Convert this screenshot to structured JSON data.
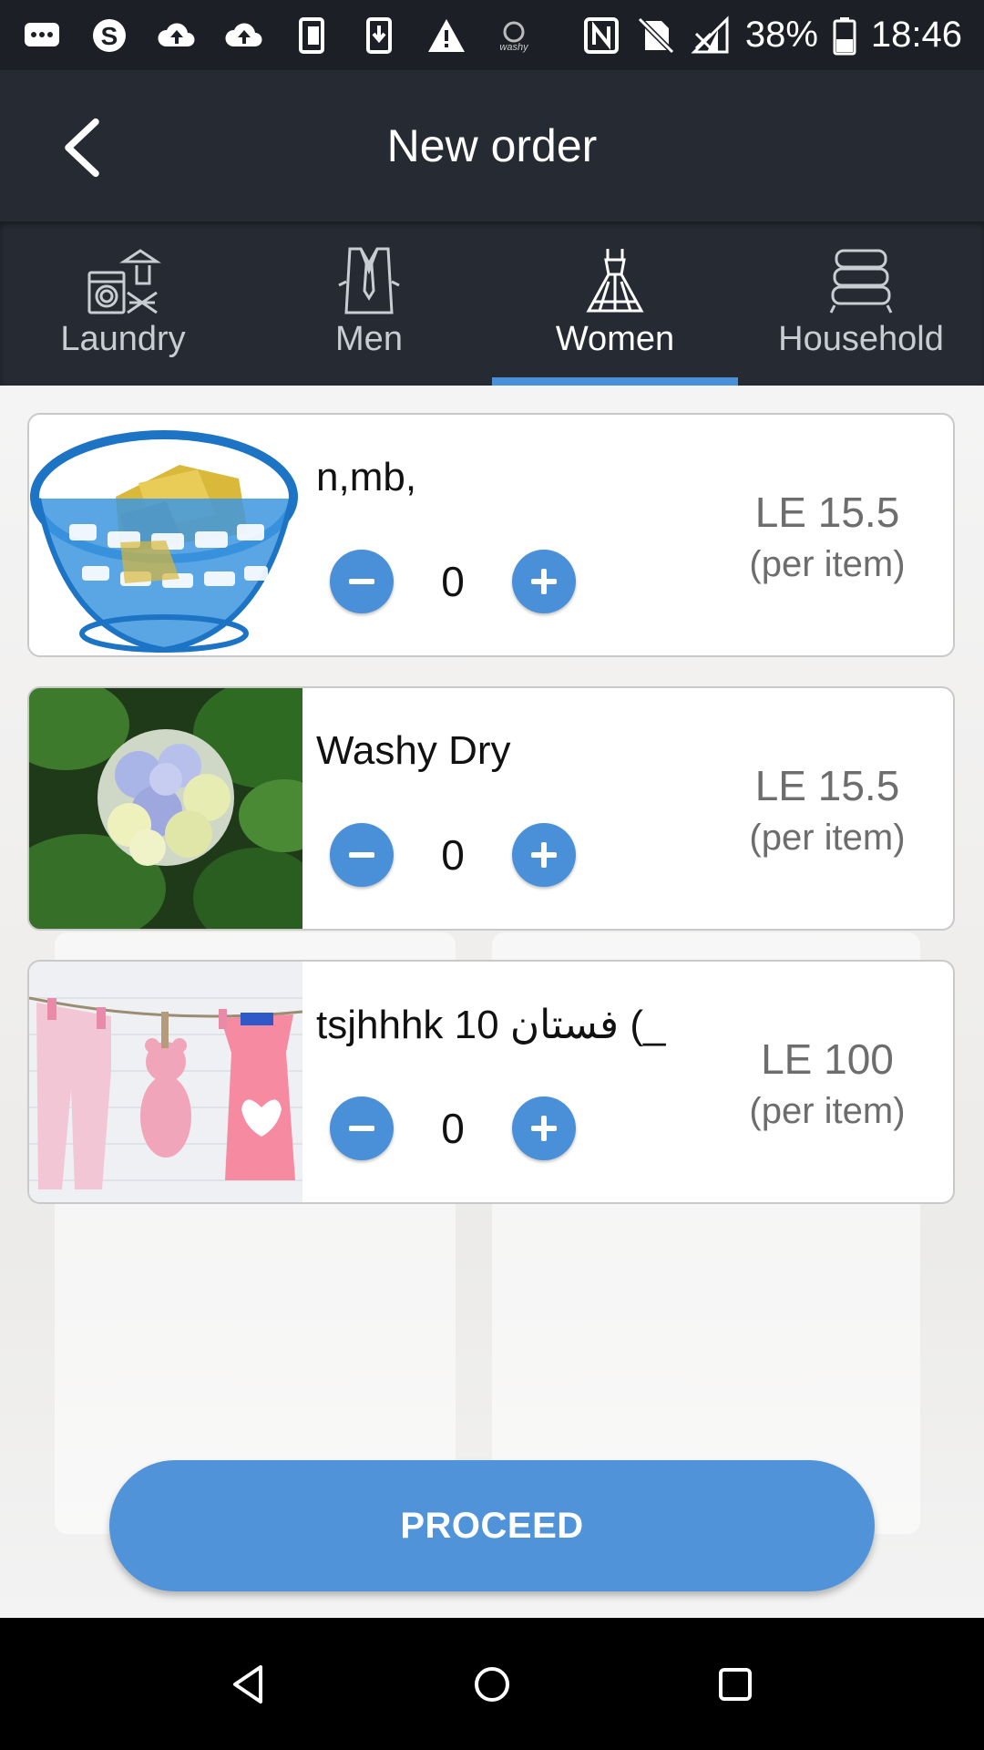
{
  "status_bar": {
    "battery_percent": "38%",
    "time": "18:46",
    "icons": [
      "messages-icon",
      "skype-icon",
      "cloud-upload-icon",
      "cloud-upload-icon",
      "phone-rotate-icon",
      "download-icon",
      "warning-icon",
      "washy-app-icon",
      "nfc-icon",
      "no-sim-icon",
      "no-signal-icon",
      "battery-icon"
    ]
  },
  "app_bar": {
    "title": "New order",
    "back_icon": "chevron-left-icon"
  },
  "tabs": [
    {
      "label": "Laundry",
      "icon": "laundry-icon",
      "active": false
    },
    {
      "label": "Men",
      "icon": "men-shirt-icon",
      "active": false
    },
    {
      "label": "Women",
      "icon": "women-dress-icon",
      "active": true
    },
    {
      "label": "Household",
      "icon": "household-linen-icon",
      "active": false
    }
  ],
  "items": [
    {
      "name": "n,mb,",
      "quantity": "0",
      "price": "LE 15.5",
      "unit": "(per item)",
      "image": "laundry-basket-image"
    },
    {
      "name": "Washy Dry",
      "quantity": "0",
      "price": "LE 15.5",
      "unit": "(per item)",
      "image": "hydrangea-flower-image"
    },
    {
      "name": "tsjhhhk 10 فستان (_",
      "quantity": "0",
      "price": "LE 100",
      "unit": "(per item)",
      "image": "clothesline-image"
    }
  ],
  "proceed": {
    "label": "PROCEED"
  },
  "colors": {
    "accent": "#4a90d9",
    "header": "#262a33",
    "status_bar": "#1c1f26"
  }
}
